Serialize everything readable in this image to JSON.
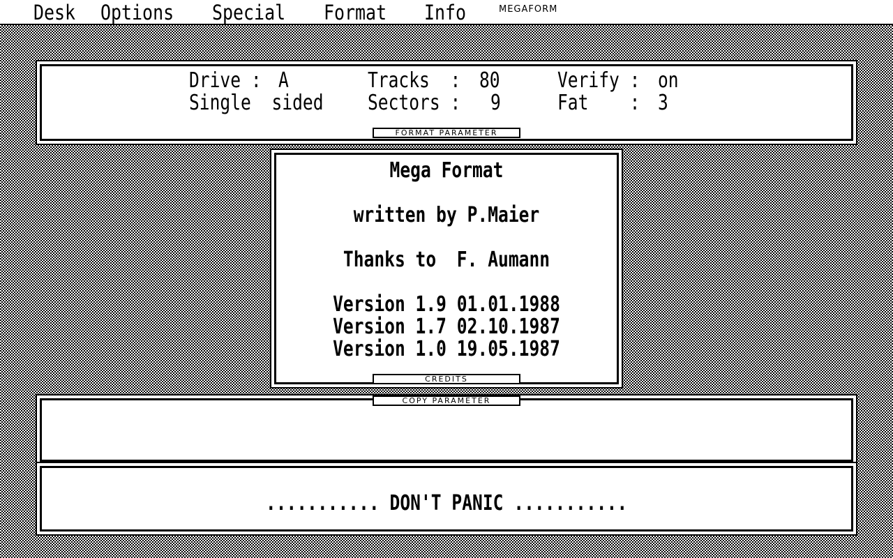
{
  "menubar": {
    "items": [
      "Desk",
      "Options",
      "Special",
      "Format",
      "Info"
    ],
    "app_label": "MEGAFORM"
  },
  "format_parameter": {
    "caption": "FORMAT PARAMETER",
    "drive_label": "Drive :",
    "drive_value": "A",
    "sides": "Single  sided",
    "tracks_label": "Tracks  :",
    "tracks_value": "80",
    "sectors_label": "Sectors :",
    "sectors_value": "9",
    "verify_label": "Verify :",
    "verify_value": "on",
    "fat_label": "Fat    :",
    "fat_value": "3"
  },
  "credits": {
    "caption": "CREDITS",
    "title": "Mega Format",
    "author": "written by P.Maier",
    "thanks": "Thanks to  F. Aumann",
    "versions": [
      "Version 1.9 01.01.1988",
      "Version 1.7 02.10.1987",
      "Version 1.0 19.05.1987"
    ]
  },
  "copy_parameter": {
    "caption": "COPY PARAMETER"
  },
  "status": {
    "message": "........... DON'T PANIC ..........."
  }
}
